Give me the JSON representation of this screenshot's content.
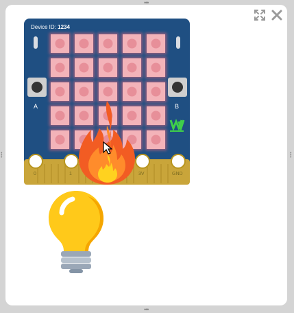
{
  "device": {
    "id_label": "Device ID:",
    "id_value": "1234"
  },
  "buttons": {
    "a_label": "A",
    "b_label": "B"
  },
  "pins": [
    "0",
    "1",
    "2",
    "3V",
    "GND"
  ],
  "logo_text": "WAVESHARE",
  "toolbar": {
    "expand_icon": "fullscreen-icon",
    "close_icon": "close-icon"
  },
  "led_matrix": {
    "rows": 5,
    "cols": 5,
    "state": "lit"
  },
  "colors": {
    "board": "#1f4f82",
    "led": "#f3b3b9",
    "edge_connector": "#c9a53a",
    "bulb": "#ffc91a"
  }
}
